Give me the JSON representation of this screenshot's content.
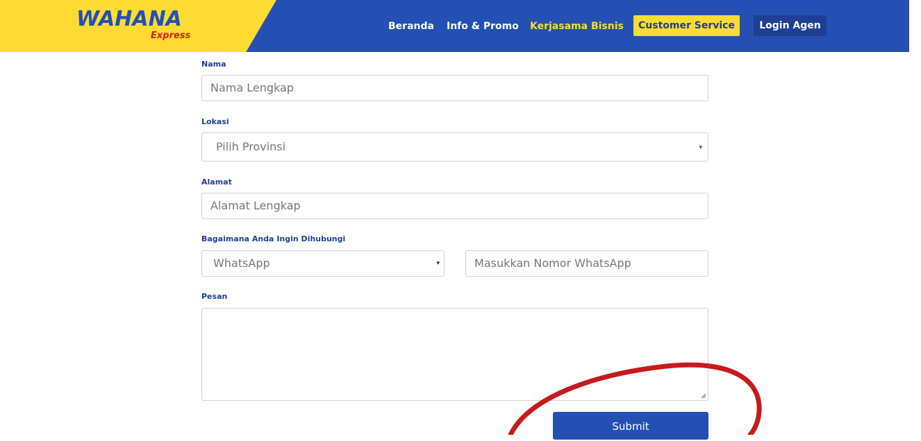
{
  "brand": {
    "logo_main": "WAHANA",
    "logo_sub": "Express",
    "colors": {
      "blue": "#2450b3",
      "yellow": "#fddb33",
      "red": "#d61f26"
    }
  },
  "nav": {
    "items": [
      {
        "label": "Beranda"
      },
      {
        "label": "Info & Promo"
      },
      {
        "label": "Kerjasama Bisnis"
      }
    ],
    "customer_service": "Customer Service",
    "login": "Login Agen"
  },
  "form": {
    "nama_label": "Nama",
    "nama_placeholder": "Nama Lengkap",
    "lokasi_label": "Lokasi",
    "lokasi_selected": "Pilih Provinsi",
    "alamat_label": "Alamat",
    "alamat_placeholder": "Alamat Lengkap",
    "kontak_label": "Bagaimana Anda Ingin Dihubungi",
    "kontak_selected": "WhatsApp",
    "kontak_placeholder": "Masukkan Nomor WhatsApp",
    "pesan_label": "Pesan",
    "submit_label": "Submit"
  },
  "icons": {
    "dropdown": "▾"
  },
  "annotation_color": "#c8191e"
}
